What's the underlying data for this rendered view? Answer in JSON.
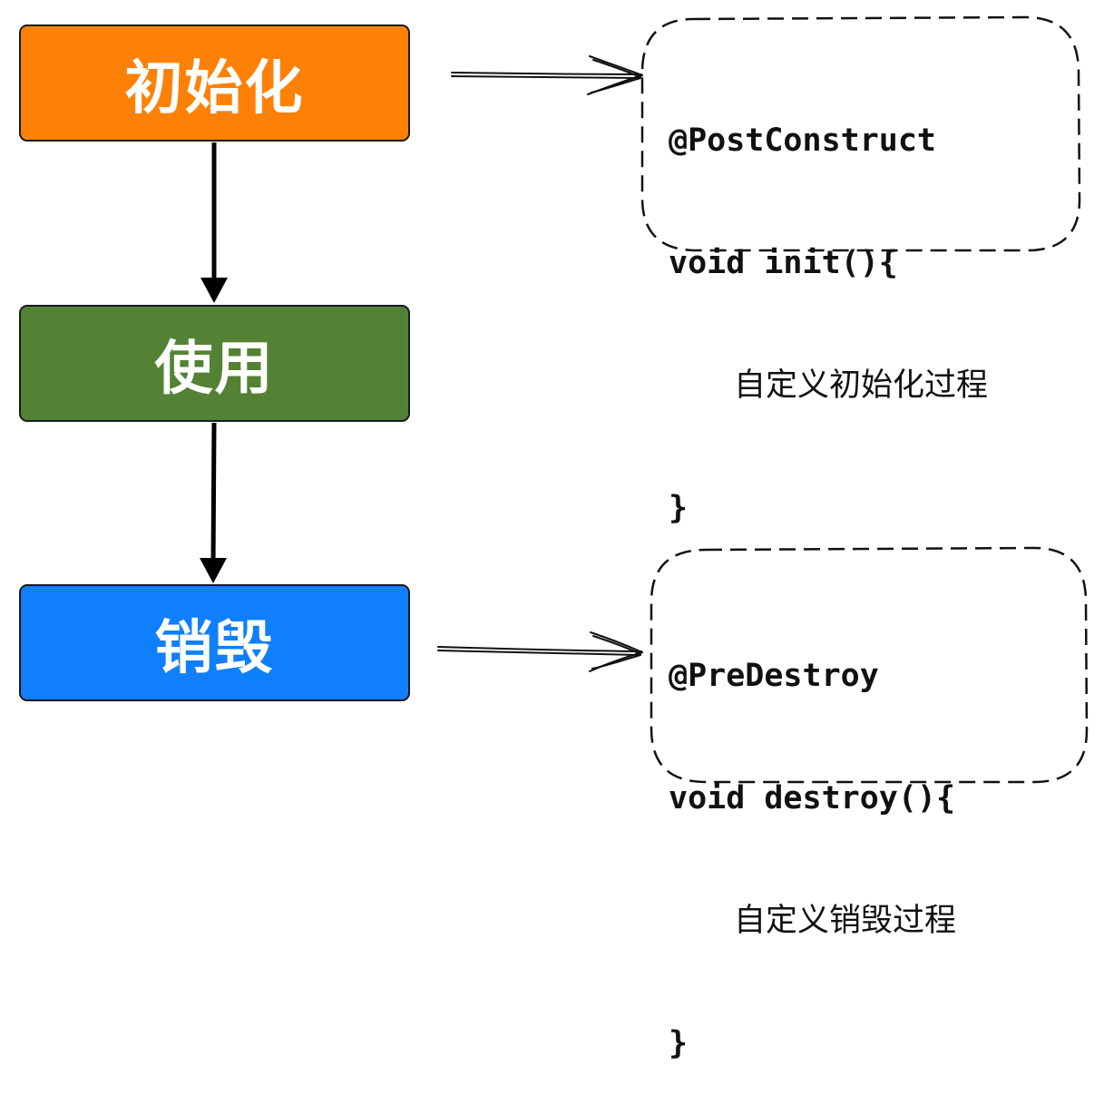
{
  "stages": {
    "init": "初始化",
    "use": "使用",
    "destroy": "销毁"
  },
  "notes": {
    "init": {
      "annotation": "@PostConstruct",
      "signature": "void init(){",
      "body": "自定义初始化过程",
      "close": "}"
    },
    "destroy": {
      "annotation": "@PreDestroy",
      "signature": "void destroy(){",
      "body": "自定义销毁过程",
      "close": "}"
    }
  },
  "colors": {
    "init": "#fd8107",
    "use": "#548235",
    "destroy": "#0f7ffd"
  }
}
